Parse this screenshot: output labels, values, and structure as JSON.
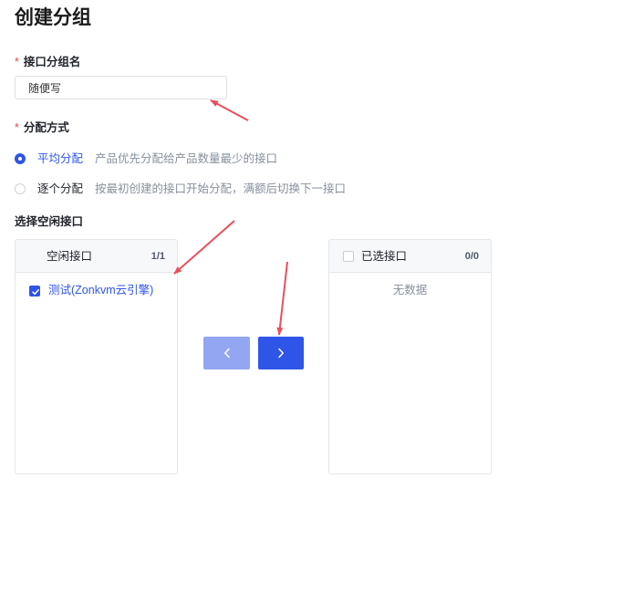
{
  "page": {
    "title": "创建分组"
  },
  "group_name": {
    "required_mark": "*",
    "label": "接口分组名",
    "value": "随便写"
  },
  "assign_mode": {
    "required_mark": "*",
    "label": "分配方式",
    "options": [
      {
        "label": "平均分配",
        "desc": "产品优先分配给产品数量最少的接口",
        "checked": true
      },
      {
        "label": "逐个分配",
        "desc": "按最初创建的接口开始分配，满额后切换下一接口",
        "checked": false
      }
    ]
  },
  "select_ports": {
    "label": "选择空闲接口"
  },
  "transfer": {
    "left": {
      "title": "空闲接口",
      "count": "1/1",
      "items": [
        {
          "label": "测试(Zonkvm云引擎)",
          "checked": true
        }
      ]
    },
    "right": {
      "title": "已选接口",
      "count": "0/0",
      "header_checked": false,
      "empty_text": "无数据"
    },
    "buttons": {
      "move_left_icon": "chevron-left-icon",
      "move_right_icon": "chevron-right-icon"
    }
  },
  "colors": {
    "primary": "#2f55e8",
    "primary_disabled": "#93a6f1",
    "required": "#e5484d",
    "annotation": "#e8505b"
  }
}
